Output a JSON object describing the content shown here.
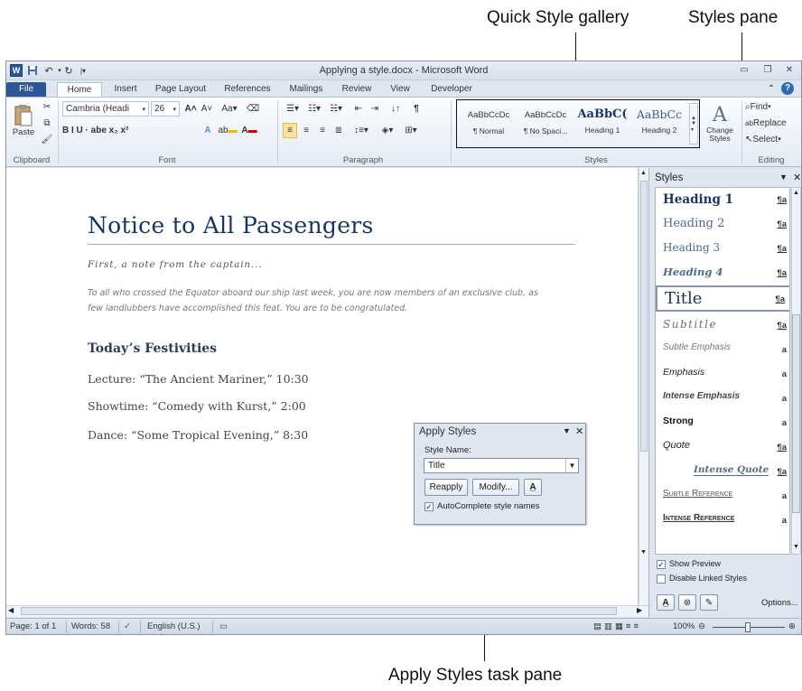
{
  "callouts": {
    "quick_style": "Quick Style gallery",
    "styles_pane": "Styles pane",
    "apply_styles": "Apply Styles task pane"
  },
  "titlebar": {
    "title": "Applying a style.docx - Microsoft Word",
    "app_icon": "W"
  },
  "tabs": [
    "File",
    "Home",
    "Insert",
    "Page Layout",
    "References",
    "Mailings",
    "Review",
    "View",
    "Developer"
  ],
  "ribbon": {
    "clipboard": {
      "paste": "Paste",
      "label": "Clipboard"
    },
    "font": {
      "font_name": "Cambria (Headi",
      "font_size": "26",
      "label": "Font",
      "row2": "B  I  U  ·  abe  x₂  x²"
    },
    "paragraph": {
      "label": "Paragraph"
    },
    "styles": {
      "label": "Styles",
      "tiles": [
        {
          "sample": "AaBbCcDc",
          "name": "¶ Normal"
        },
        {
          "sample": "AaBbCcDc",
          "name": "¶ No Spaci..."
        },
        {
          "sample": "AaBbC(",
          "name": "Heading 1"
        },
        {
          "sample": "AaBbCc",
          "name": "Heading 2"
        }
      ],
      "change_styles": "Change Styles"
    },
    "editing": {
      "label": "Editing",
      "find": "Find",
      "replace": "Replace",
      "select": "Select"
    }
  },
  "document": {
    "title": "Notice to All Passengers",
    "subtitle": "First, a note from the captain...",
    "para_line1": "To all who crossed the Equator aboard our ship last week, you are now members of an exclusive club, as",
    "para_line2": "few landlubbers have accomplished this feat. You are to be congratulated.",
    "heading": "Today’s Festivities",
    "lines": [
      "Lecture: “The Ancient Mariner,” 10:30",
      "Showtime: “Comedy with Kurst,” 2:00",
      "Dance: “Some Tropical Evening,” 8:30"
    ]
  },
  "apply_styles": {
    "title": "Apply Styles",
    "style_name_label": "Style Name:",
    "style_name_value": "Title",
    "reapply": "Reapply",
    "modify": "Modify...",
    "autocomplete": "AutoComplete style names"
  },
  "styles_pane": {
    "title": "Styles",
    "items": [
      {
        "name": "Heading 1",
        "mark": "¶a"
      },
      {
        "name": "Heading 2",
        "mark": "¶a"
      },
      {
        "name": "Heading 3",
        "mark": "¶a"
      },
      {
        "name": "Heading 4",
        "mark": "¶a"
      },
      {
        "name": "Title",
        "mark": "¶a"
      },
      {
        "name": "Subtitle",
        "mark": "¶a"
      },
      {
        "name": "Subtle Emphasis",
        "mark": "a"
      },
      {
        "name": "Emphasis",
        "mark": "a"
      },
      {
        "name": "Intense Emphasis",
        "mark": "a"
      },
      {
        "name": "Strong",
        "mark": "a"
      },
      {
        "name": "Quote",
        "mark": "¶a"
      },
      {
        "name": "Intense Quote",
        "mark": "¶a"
      },
      {
        "name": "Subtle Reference",
        "mark": "a"
      },
      {
        "name": "Intense Reference",
        "mark": "a"
      }
    ],
    "show_preview": "Show Preview",
    "disable_linked": "Disable Linked Styles",
    "options": "Options..."
  },
  "statusbar": {
    "page": "Page: 1 of 1",
    "words": "Words: 58",
    "language": "English (U.S.)",
    "zoom": "100%"
  }
}
